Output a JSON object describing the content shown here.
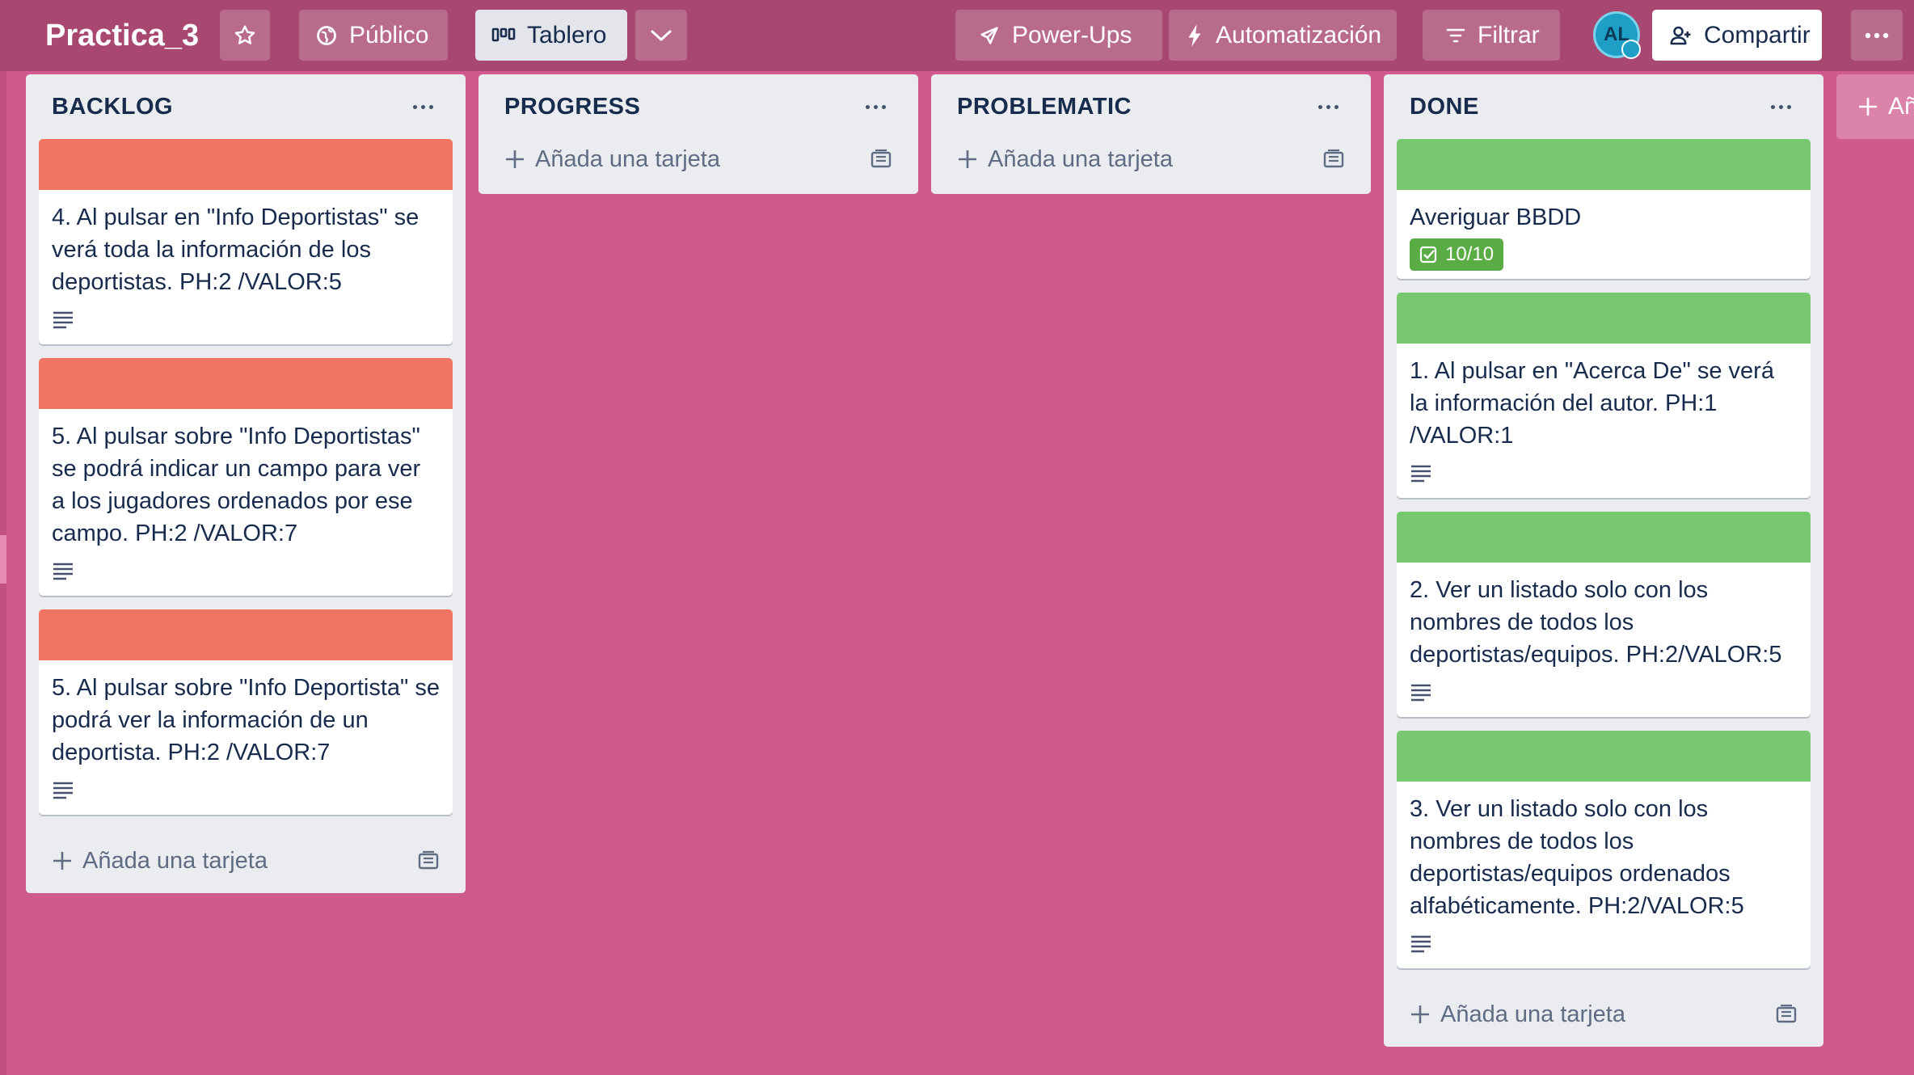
{
  "header": {
    "board_title": "Practica_3",
    "visibility_label": "Público",
    "view_label": "Tablero",
    "powerups_label": "Power-Ups",
    "automation_label": "Automatización",
    "filter_label": "Filtrar",
    "avatar_initials": "AL",
    "share_label": "Compartir"
  },
  "add_card_label": "Añada una tarjeta",
  "add_list_label": "Añ",
  "lists": [
    {
      "title": "BACKLOG",
      "cards": [
        {
          "label_color": "#F07562",
          "text": "4. Al pulsar en \"Info Deportistas\" se verá toda la información de los deportistas. PH:2 /VALOR:5",
          "has_description": true
        },
        {
          "label_color": "#F07562",
          "text": "5. Al pulsar sobre \"Info Deportistas\" se podrá indicar un campo para ver a los jugadores ordenados por ese campo. PH:2 /VALOR:7",
          "has_description": true
        },
        {
          "label_color": "#F07562",
          "text": "5. Al pulsar sobre \"Info Deportista\" se podrá ver la información de un deportista. PH:2 /VALOR:7",
          "has_description": true
        }
      ]
    },
    {
      "title": "PROGRESS",
      "cards": []
    },
    {
      "title": "PROBLEMATIC",
      "cards": []
    },
    {
      "title": "DONE",
      "cards": [
        {
          "label_color": "#77C86E",
          "text": "Averiguar BBDD",
          "checklist": "10/10"
        },
        {
          "label_color": "#77C86E",
          "text": "1. Al pulsar en \"Acerca De\" se verá la información del autor. PH:1 /VALOR:1",
          "has_description": true
        },
        {
          "label_color": "#77C86E",
          "text": "2. Ver un listado solo con los nombres de todos los deportistas/equipos. PH:2/VALOR:5",
          "has_description": true
        },
        {
          "label_color": "#77C86E",
          "text": "3. Ver un listado solo con los nombres de todos los deportistas/equipos ordenados alfabéticamente. PH:2/VALOR:5",
          "has_description": true
        }
      ]
    }
  ],
  "colors": {
    "board_background": "#D05A8E",
    "header_background": "#A8476F",
    "label_red": "#F07562",
    "label_green": "#77C86E",
    "checklist_complete": "#5AAC44"
  },
  "icons": [
    "star-icon",
    "globe-icon",
    "board-icon",
    "chevron-down-icon",
    "rocket-icon",
    "lightning-icon",
    "filter-icon",
    "add-user-icon",
    "more-icon",
    "plus-icon",
    "template-icon",
    "description-icon",
    "checklist-icon"
  ]
}
